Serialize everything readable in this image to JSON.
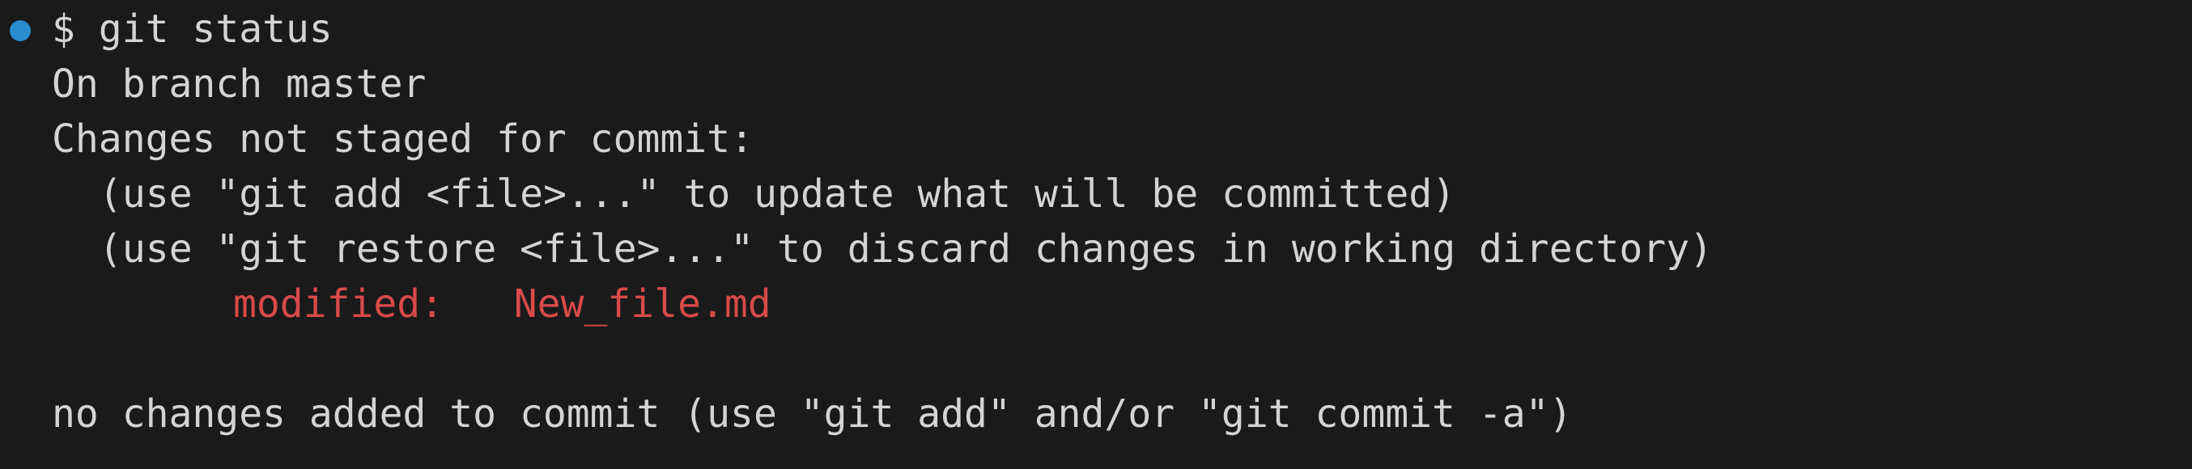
{
  "terminal": {
    "status_indicator_color": "#2b8ccf",
    "lines": {
      "command": "$ git status",
      "branch": "On branch master",
      "changes_header": "Changes not staged for commit:",
      "hint_add": "(use \"git add <file>...\" to update what will be committed)",
      "hint_restore": "(use \"git restore <file>...\" to discard changes in working directory)",
      "modified_entry": "modified:   New_file.md",
      "summary": "no changes added to commit (use \"git add\" and/or \"git commit -a\")"
    },
    "colors": {
      "background": "#1a1a1a",
      "text": "#d4d4d4",
      "modified": "#d84a4a"
    }
  }
}
